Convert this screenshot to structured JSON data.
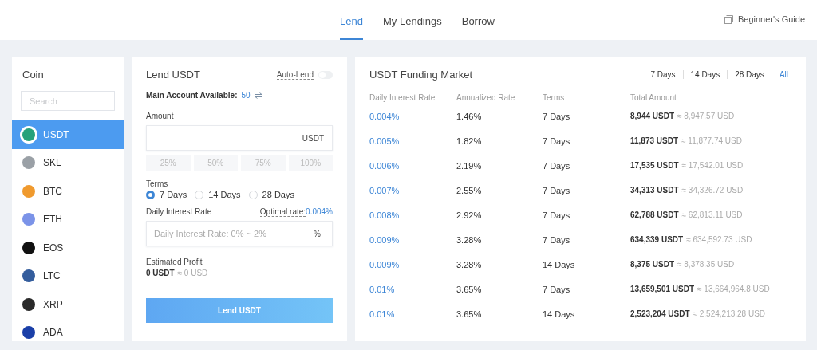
{
  "nav": {
    "tabs": [
      {
        "label": "Lend",
        "selected": true
      },
      {
        "label": "My Lendings",
        "selected": false
      },
      {
        "label": "Borrow",
        "selected": false
      }
    ],
    "guide": "Beginner's Guide"
  },
  "coins": {
    "title": "Coin",
    "search": {
      "placeholder": "Search"
    },
    "items": [
      {
        "name": "USDT",
        "color": "#26a17b",
        "selected": true
      },
      {
        "name": "SKL",
        "color": "#9aa0a6",
        "selected": false
      },
      {
        "name": "BTC",
        "color": "#f09a2e",
        "selected": false
      },
      {
        "name": "ETH",
        "color": "#7b93e8",
        "selected": false
      },
      {
        "name": "EOS",
        "color": "#111111",
        "selected": false
      },
      {
        "name": "LTC",
        "color": "#345d9d",
        "selected": false
      },
      {
        "name": "XRP",
        "color": "#2a2a2a",
        "selected": false
      },
      {
        "name": "ADA",
        "color": "#1a3fa8",
        "selected": false
      }
    ]
  },
  "lend": {
    "title": "Lend USDT",
    "auto_lend": {
      "label": "Auto-Lend",
      "on": false
    },
    "available_label": "Main Account Available:",
    "available_value": "50",
    "amount_label": "Amount",
    "amount_unit": "USDT",
    "percents": [
      "25%",
      "50%",
      "75%",
      "100%"
    ],
    "terms_label": "Terms",
    "terms": [
      {
        "label": "7 Days",
        "selected": true
      },
      {
        "label": "14 Days",
        "selected": false
      },
      {
        "label": "28 Days",
        "selected": false
      }
    ],
    "rate_label": "Daily Interest Rate",
    "optimal_label": "Optimal rate:",
    "optimal_value": "0.004%",
    "rate_field": {
      "placeholder": "Daily Interest Rate: 0% ~ 2%",
      "unit": "%"
    },
    "profit_label": "Estimated Profit",
    "profit_value": "0 USDT",
    "profit_usd": "≈ 0 USD",
    "button": "Lend USDT"
  },
  "market": {
    "title": "USDT Funding Market",
    "filters": [
      {
        "label": "7 Days",
        "selected": false
      },
      {
        "label": "14 Days",
        "selected": false
      },
      {
        "label": "28 Days",
        "selected": false
      },
      {
        "label": "All",
        "selected": true
      }
    ],
    "columns": [
      "Daily Interest Rate",
      "Annualized Rate",
      "Terms",
      "Total Amount"
    ],
    "rows": [
      {
        "daily": "0.004%",
        "annual": "1.46%",
        "terms": "7 Days",
        "amount": "8,944 USDT",
        "usd": "≈ 8,947.57 USD"
      },
      {
        "daily": "0.005%",
        "annual": "1.82%",
        "terms": "7 Days",
        "amount": "11,873 USDT",
        "usd": "≈ 11,877.74 USD"
      },
      {
        "daily": "0.006%",
        "annual": "2.19%",
        "terms": "7 Days",
        "amount": "17,535 USDT",
        "usd": "≈ 17,542.01 USD"
      },
      {
        "daily": "0.007%",
        "annual": "2.55%",
        "terms": "7 Days",
        "amount": "34,313 USDT",
        "usd": "≈ 34,326.72 USD"
      },
      {
        "daily": "0.008%",
        "annual": "2.92%",
        "terms": "7 Days",
        "amount": "62,788 USDT",
        "usd": "≈ 62,813.11 USD"
      },
      {
        "daily": "0.009%",
        "annual": "3.28%",
        "terms": "7 Days",
        "amount": "634,339 USDT",
        "usd": "≈ 634,592.73 USD"
      },
      {
        "daily": "0.009%",
        "annual": "3.28%",
        "terms": "14 Days",
        "amount": "8,375 USDT",
        "usd": "≈ 8,378.35 USD"
      },
      {
        "daily": "0.01%",
        "annual": "3.65%",
        "terms": "7 Days",
        "amount": "13,659,501 USDT",
        "usd": "≈ 13,664,964.8 USD"
      },
      {
        "daily": "0.01%",
        "annual": "3.65%",
        "terms": "14 Days",
        "amount": "2,523,204 USDT",
        "usd": "≈ 2,524,213.28 USD"
      }
    ]
  }
}
